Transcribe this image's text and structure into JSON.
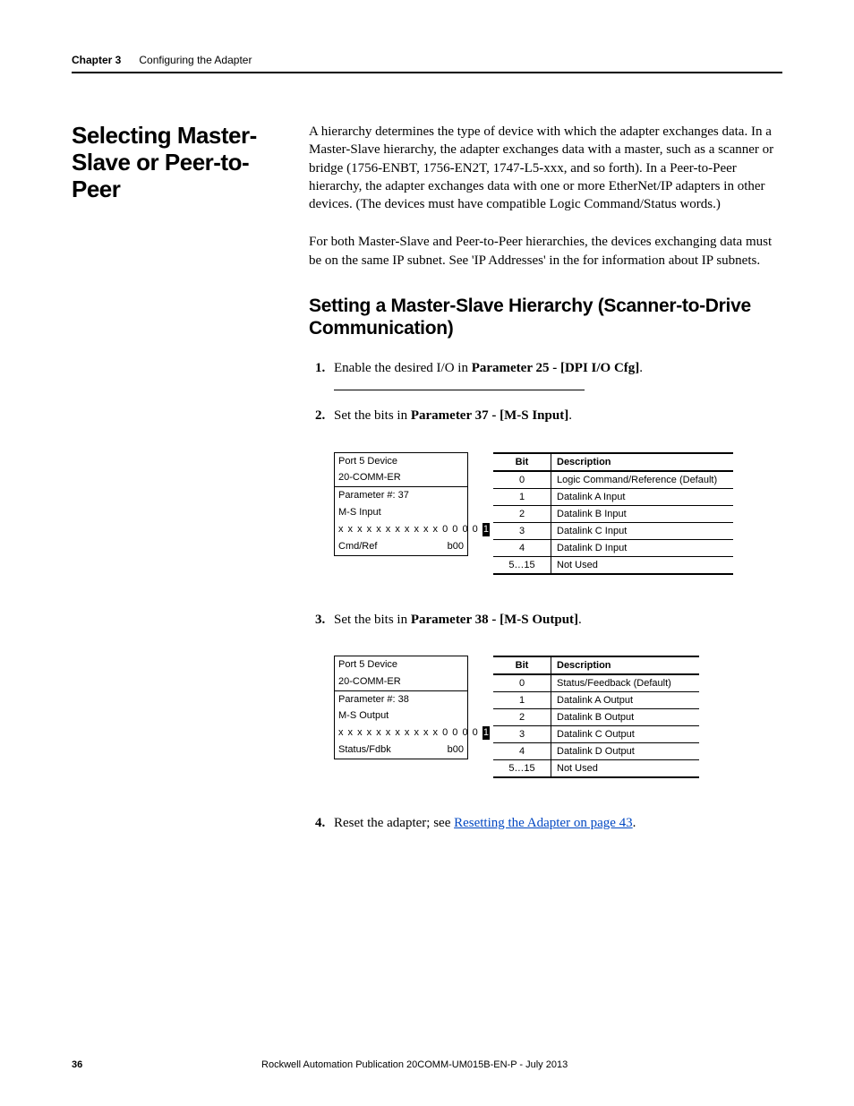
{
  "header": {
    "chapter": "Chapter 3",
    "title": "Configuring the Adapter"
  },
  "section": {
    "title": "Selecting Master-Slave or Peer-to-Peer",
    "para1": "A hierarchy determines the type of device with which the adapter exchanges data. In a Master-Slave hierarchy, the adapter exchanges data with a master, such as a scanner or bridge (1756-ENBT, 1756-EN2T, 1747-L5-xxx, and so forth). In a Peer-to-Peer hierarchy, the adapter exchanges data with one or more EtherNet/IP adapters in other devices. (The devices must have compatible Logic Command/Status words.)",
    "para2": "For both Master-Slave and Peer-to-Peer hierarchies, the devices exchanging data must be on the same IP subnet. See 'IP Addresses' in the  for information about IP subnets.",
    "sub_heading": "Setting a Master-Slave Hierarchy (Scanner-to-Drive Communication)"
  },
  "steps": {
    "s1_a": "Enable the desired I/O in ",
    "s1_b": "Parameter 25 - [DPI I/O Cfg]",
    "s1_c": ".",
    "s2_a": "Set the bits in ",
    "s2_b": "Parameter 37 - [M-S Input]",
    "s2_c": ".",
    "s3_a": "Set the bits in ",
    "s3_b": "Parameter 38 - [M-S Output]",
    "s3_c": ".",
    "s4_a": "Reset the adapter; see ",
    "s4_link": "Resetting the Adapter on page 43",
    "s4_c": "."
  },
  "lcd37": {
    "l1": "Port 5 Device",
    "l2": "20-COMM-ER",
    "l3": "Parameter #: 37",
    "l4": "M-S Input",
    "bits_prefix": "x x x x x x x x x x x 0 0 0 0",
    "bits_inv": "1",
    "last_left": "Cmd/Ref",
    "last_right": "b00"
  },
  "lcd38": {
    "l1": "Port 5 Device",
    "l2": "20-COMM-ER",
    "l3": "Parameter #: 38",
    "l4": "M-S Output",
    "bits_prefix": "x x x x x x x x x x x 0 0 0 0",
    "bits_inv": "1",
    "last_left": "Status/Fdbk",
    "last_right": "b00"
  },
  "table37": {
    "head_bit": "Bit",
    "head_desc": "Description",
    "rows": [
      {
        "bit": "0",
        "desc": "Logic Command/Reference (Default)"
      },
      {
        "bit": "1",
        "desc": "Datalink A Input"
      },
      {
        "bit": "2",
        "desc": "Datalink B Input"
      },
      {
        "bit": "3",
        "desc": "Datalink C Input"
      },
      {
        "bit": "4",
        "desc": "Datalink D Input"
      },
      {
        "bit": "5…15",
        "desc": "Not Used"
      }
    ]
  },
  "table38": {
    "head_bit": "Bit",
    "head_desc": "Description",
    "rows": [
      {
        "bit": "0",
        "desc": "Status/Feedback (Default)"
      },
      {
        "bit": "1",
        "desc": "Datalink A Output"
      },
      {
        "bit": "2",
        "desc": "Datalink B Output"
      },
      {
        "bit": "3",
        "desc": "Datalink C Output"
      },
      {
        "bit": "4",
        "desc": "Datalink D Output"
      },
      {
        "bit": "5…15",
        "desc": "Not Used"
      }
    ]
  },
  "footer": {
    "page": "36",
    "pub": "Rockwell Automation Publication 20COMM-UM015B-EN-P - July 2013"
  }
}
